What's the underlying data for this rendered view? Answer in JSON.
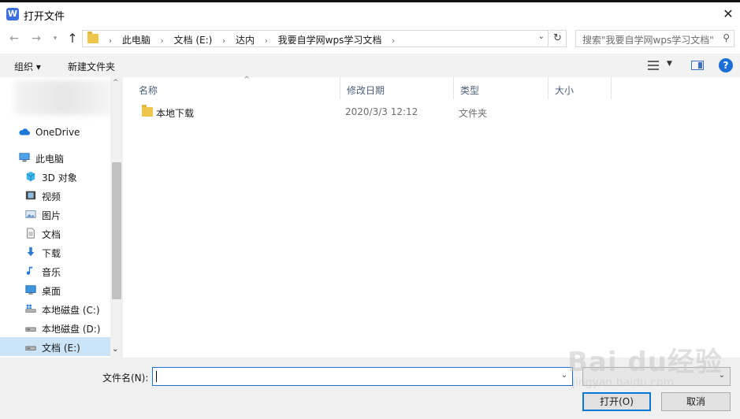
{
  "window": {
    "title": "打开文件",
    "app_icon_glyph": "W",
    "close_glyph": "✕"
  },
  "address": {
    "crumbs": [
      "此电脑",
      "文档 (E:)",
      "达内",
      "我要自学网wps学习文档"
    ],
    "search_placeholder": "搜索\"我要自学网wps学习文档\""
  },
  "toolbar": {
    "organize_label": "组织 ▾",
    "new_folder_label": "新建文件夹",
    "help_glyph": "?"
  },
  "nav": {
    "items": [
      {
        "label": "OneDrive",
        "icon": "cloud-icon"
      },
      {
        "label": "此电脑",
        "icon": "computer-icon"
      },
      {
        "label": "3D 对象",
        "icon": "cube-icon"
      },
      {
        "label": "视频",
        "icon": "video-icon"
      },
      {
        "label": "图片",
        "icon": "picture-icon"
      },
      {
        "label": "文档",
        "icon": "document-icon"
      },
      {
        "label": "下载",
        "icon": "download-icon"
      },
      {
        "label": "音乐",
        "icon": "music-icon"
      },
      {
        "label": "桌面",
        "icon": "desktop-icon"
      },
      {
        "label": "本地磁盘 (C:)",
        "icon": "drive-c-icon"
      },
      {
        "label": "本地磁盘 (D:)",
        "icon": "drive-icon"
      },
      {
        "label": "文档 (E:)",
        "icon": "drive-icon"
      }
    ]
  },
  "list": {
    "columns": {
      "name": "名称",
      "date": "修改日期",
      "type": "类型",
      "size": "大小"
    },
    "rows": [
      {
        "name": "本地下载",
        "date": "2020/3/3 12:12",
        "type": "文件夹",
        "size": ""
      }
    ]
  },
  "bottom": {
    "filename_label": "文件名(N):",
    "filename_value": "",
    "open_label": "打开(O)",
    "cancel_label": "取消"
  },
  "watermark": {
    "text": "Bai du经验",
    "sub": "jingyan.baidu.com"
  },
  "colors": {
    "accent": "#0078d7",
    "selection": "#cce4f7",
    "folder": "#f0c64a",
    "toolbar_bg": "#f2f2f2"
  }
}
